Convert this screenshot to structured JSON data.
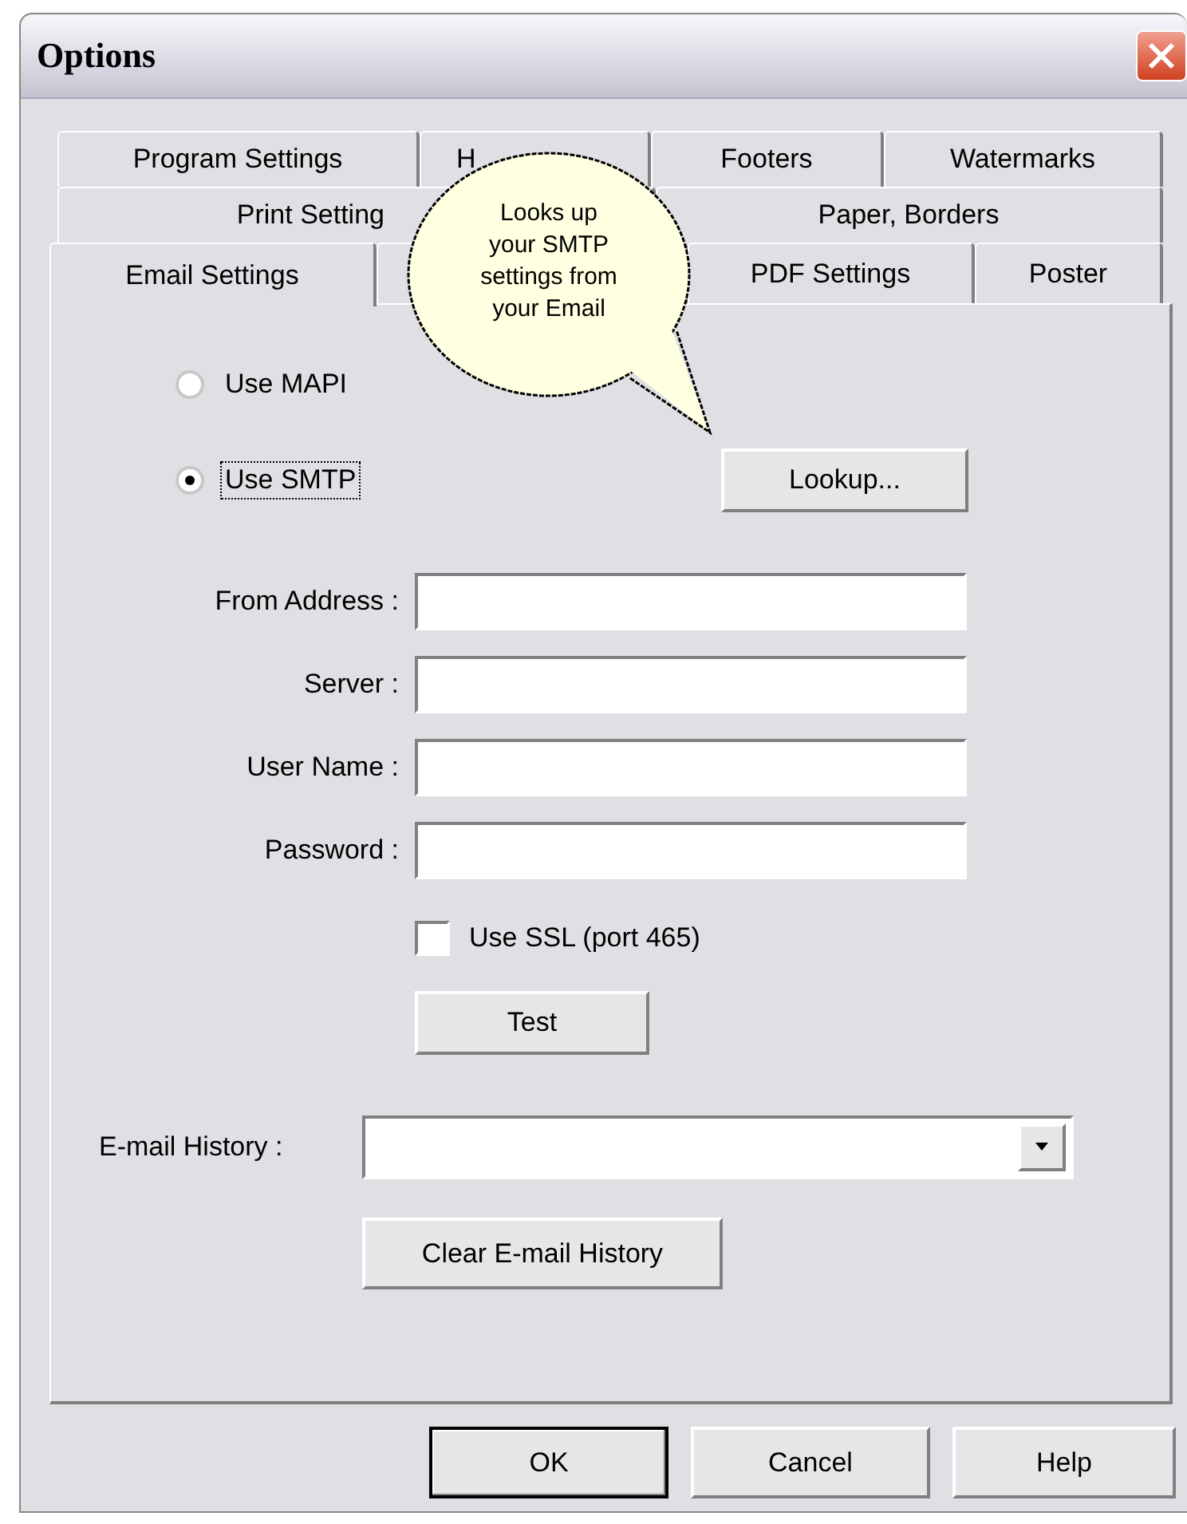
{
  "window": {
    "title": "Options"
  },
  "tab_rows": [
    [
      {
        "label": "Program Settings",
        "selected": false
      },
      {
        "label": "H",
        "selected": false
      },
      {
        "label": "Footers",
        "selected": false
      },
      {
        "label": "Watermarks",
        "selected": false
      }
    ],
    [
      {
        "label": "Print Setting",
        "selected": false
      },
      {
        "label": "Paper, Borders",
        "selected": false
      }
    ],
    [
      {
        "label": "Email Settings",
        "selected": true
      },
      {
        "selected": false
      },
      {
        "label": "PDF Settings",
        "selected": false
      },
      {
        "label": "Poster",
        "selected": false
      }
    ]
  ],
  "callout": {
    "lines": [
      "Looks up",
      "your SMTP",
      "settings from",
      "your Email"
    ]
  },
  "radios": [
    {
      "label": "Use MAPI",
      "selected": false,
      "focused": false
    },
    {
      "label": "Use SMTP",
      "selected": true,
      "focused": true
    }
  ],
  "lookup_button": "Lookup...",
  "fields": [
    {
      "label": "From Address :"
    },
    {
      "label": "Server :"
    },
    {
      "label": "User Name :"
    },
    {
      "label": "Password :"
    }
  ],
  "ssl_checkbox": {
    "label": "Use SSL (port 465)",
    "checked": false
  },
  "test_button": "Test",
  "history": {
    "label": "E-mail History :"
  },
  "clear_button": "Clear E-mail History",
  "buttons": [
    {
      "label": "OK",
      "default": true
    },
    {
      "label": "Cancel",
      "default": false
    },
    {
      "label": "Help",
      "default": false
    }
  ]
}
